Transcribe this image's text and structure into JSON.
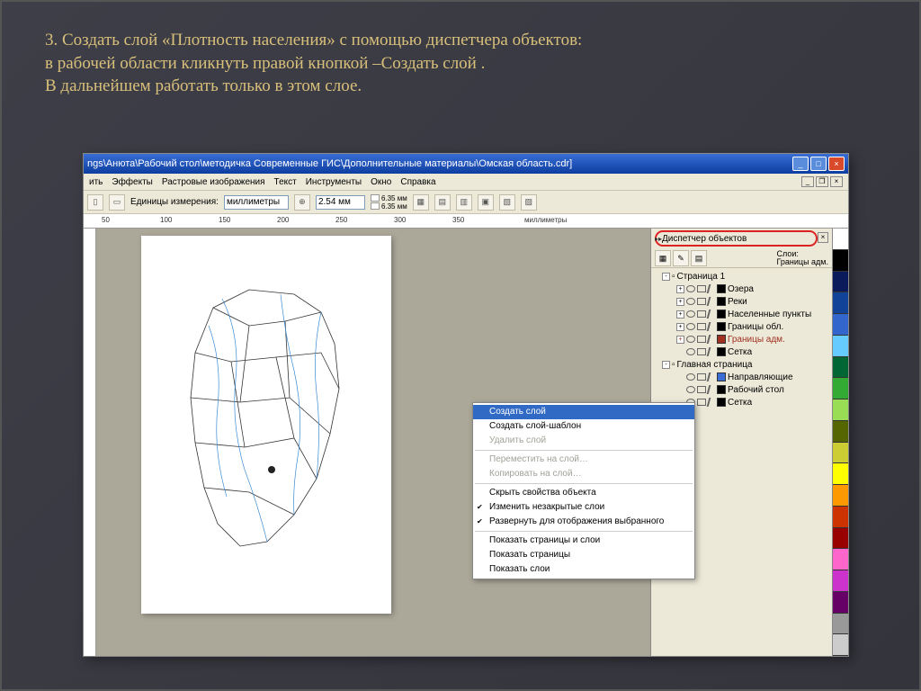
{
  "slide": {
    "text_line1": "3. Создать слой «Плотность населения» с помощью диспетчера объектов:",
    "text_line2": "в рабочей области кликнуть правой кнопкой –Создать слой .",
    "text_line3": "В дальнейшем работать только в этом слое."
  },
  "window": {
    "title": "ngs\\Анюта\\Рабочий стол\\методичка Современные ГИС\\Дополнительные материалы\\Омская область.cdr]",
    "win_minimize": "_",
    "win_maximize": "□",
    "win_close": "×"
  },
  "menu": {
    "items": [
      "Эффекты",
      "Растровые изображения",
      "Текст",
      "Инструменты",
      "Окно",
      "Справка"
    ],
    "doc_prefix": "ить"
  },
  "toolbar": {
    "units_label": "Единицы измерения:",
    "units_value": "миллиметры",
    "nudge_value": "2.54 мм",
    "dup_x": "6.35 мм",
    "dup_y": "6.35 мм"
  },
  "ruler": {
    "ticks": [
      "50",
      "100",
      "150",
      "200",
      "250",
      "300",
      "350"
    ],
    "unit_label": "миллиметры"
  },
  "docker": {
    "title": "Диспетчер объектов",
    "close": "×",
    "info_l1": "Слои:",
    "info_l2": "Границы адм.",
    "page1": "Страница 1",
    "masterpage": "Главная страница",
    "layers_p1": [
      "Озера",
      "Реки",
      "Населенные пункты",
      "Границы обл.",
      "Границы адм.",
      "Сетка"
    ],
    "layers_master": [
      "Направляющие",
      "Рабочий стол",
      "Сетка"
    ]
  },
  "context_menu": {
    "items": [
      {
        "label": "Создать слой",
        "state": "highlighted"
      },
      {
        "label": "Создать слой-шаблон",
        "state": "normal"
      },
      {
        "label": "Удалить слой",
        "state": "disabled"
      },
      {
        "type": "sep"
      },
      {
        "label": "Переместить на слой…",
        "state": "disabled"
      },
      {
        "label": "Копировать на слой…",
        "state": "disabled"
      },
      {
        "type": "sep"
      },
      {
        "label": "Скрыть свойства объекта",
        "state": "normal"
      },
      {
        "label": "Изменить незакрытые слои",
        "state": "normal",
        "checked": true
      },
      {
        "label": "Развернуть для отображения выбранного",
        "state": "normal",
        "checked": true
      },
      {
        "type": "sep"
      },
      {
        "label": "Показать страницы и слои",
        "state": "normal"
      },
      {
        "label": "Показать страницы",
        "state": "normal"
      },
      {
        "label": "Показать слои",
        "state": "normal"
      }
    ]
  },
  "colorbar": [
    "#ffffff",
    "#000000",
    "#0a1a5a",
    "#114499",
    "#3366cc",
    "#66ccff",
    "#006633",
    "#33aa33",
    "#99dd55",
    "#556600",
    "#cccc33",
    "#ffff00",
    "#ff9900",
    "#cc3300",
    "#990000",
    "#ff66cc",
    "#cc33cc",
    "#660066",
    "#999999",
    "#cccccc"
  ]
}
